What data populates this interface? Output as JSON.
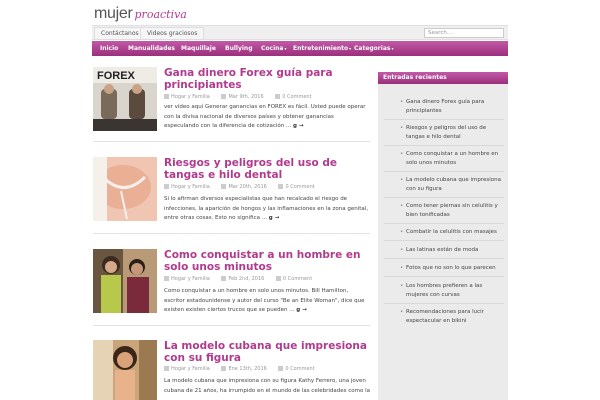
{
  "logo": {
    "part1": "mujer",
    "part2": "proactiva"
  },
  "topbar": {
    "links": [
      "Contáctanos",
      "Videos graciosos"
    ],
    "search_placeholder": "Search..."
  },
  "nav": {
    "items": [
      "Inicio",
      "Manualidades",
      "Maquillaje",
      "Bullying",
      "Cocina",
      "Entretenimiento",
      "Categorias"
    ],
    "dropdown_caret": "▾"
  },
  "posts": [
    {
      "title": "Gana dinero Forex guía para principiantes",
      "category": "Hogar y Familia",
      "date": "Mar 9th, 2016",
      "comments": "0 Comment",
      "excerpt": "ver vídeo aquí Generar ganancias en FOREX es fácil. Usted puede operar con la divisa nacional de diversos países y obtener ganancias especulando con la diferencia de cotización ...",
      "more": "g →",
      "thumb_label": "FOREX"
    },
    {
      "title": "Riesgos y peligros del uso de tangas e hilo dental",
      "category": "Hogar y Familia",
      "date": "Mar 20th, 2016",
      "comments": "0 Comment",
      "excerpt": "Si lo afirman diversos especialistas que han recalcado el riesgo de infecciones, la aparición de hongos y las inflamaciones en la zona genital, entre otras cosas. Esto no significa ...",
      "more": "g →"
    },
    {
      "title": "Como conquistar a un hombre en solo unos minutos",
      "category": "Hogar y Familia",
      "date": "Feb 2nd, 2016",
      "comments": "0 Comment",
      "excerpt": "Como conquistar a un hombre en solo unos minutos. Bill Hamilton, escritor estadounidense y autor del curso \"Be an Elite Woman\", dice que existen existen ciertos trucos que se pueden ...",
      "more": "g →"
    },
    {
      "title": "La modelo cubana que impresiona con su figura",
      "category": "Hogar y Familia",
      "date": "Ene 13th, 2016",
      "comments": "0 Comment",
      "excerpt": "La modelo cubana que impresiona con su figura Kathy Ferrero, una joven cubana de 21 años, ha irrumpido en el mundo de las celebridades como la",
      "more": ""
    }
  ],
  "sidebar": {
    "title": "Entradas recientes",
    "items": [
      "Gana dinero Forex guía para principiantes",
      "Riesgos y peligros del uso de tangas e hilo dental",
      "Como conquistar a un hombre en solo unos minutos",
      "La modelo cubana que impresiona con su figura",
      "Como tener piernas sin celulitis y bien tonificadas",
      "Combatir la celulitis con masajes",
      "Las latinas están de moda",
      "Fotos que no son lo que parecen",
      "Los hombres prefieren a las mujeres con curvas",
      "Recomendaciones para lucir espectacular en bikini"
    ]
  },
  "colors": {
    "accent": "#b03b8e",
    "nav_top": "#c15aa6",
    "nav_bottom": "#9b2f7c"
  }
}
